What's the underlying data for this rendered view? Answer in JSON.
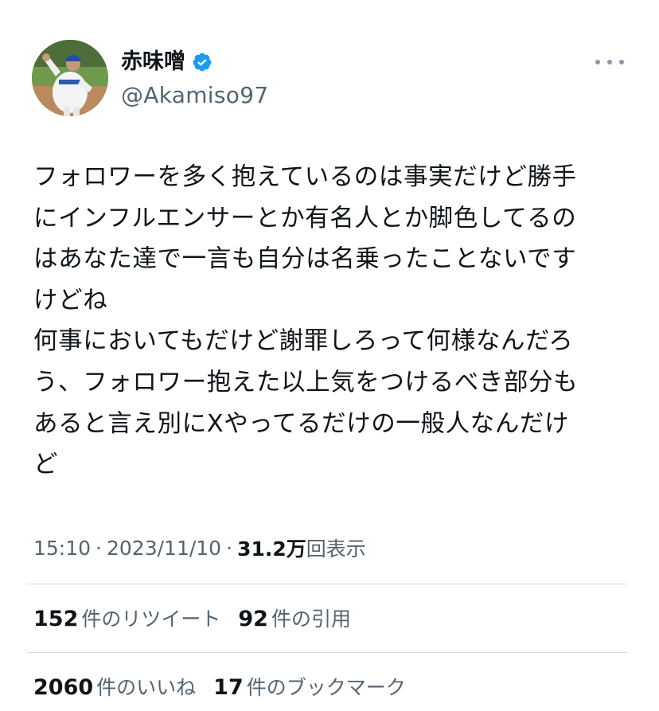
{
  "user": {
    "display_name": "赤味噌",
    "handle": "@Akamiso97",
    "verified_icon": "verified-badge-icon",
    "verified_color": "#1d9bf0"
  },
  "tweet": {
    "text": "フォロワーを多く抱えているのは事実だけど勝手\nにインフルエンサーとか有名人とか脚色してるの\nはあなた達で一言も自分は名乗ったことないです\nけどね\n何事においてもだけど謝罪しろって何様なんだろ\nう、フォロワー抱えた以上気をつけるべき部分も\nあると言え別にXやってるだけの一般人なんだけ\nど"
  },
  "meta": {
    "time": "15:10",
    "separator": "·",
    "date": "2023/11/10",
    "views_count": "31.2万",
    "views_label": "回表示"
  },
  "stats": {
    "retweets": {
      "count": "152",
      "label": "件のリツイート"
    },
    "quotes": {
      "count": "92",
      "label": "件の引用"
    },
    "likes": {
      "count": "2060",
      "label": "件のいいね"
    },
    "bookmarks": {
      "count": "17",
      "label": "件のブックマーク"
    }
  },
  "colors": {
    "text_primary": "#0f1419",
    "text_secondary": "#536471",
    "divider": "#d6dde3"
  }
}
